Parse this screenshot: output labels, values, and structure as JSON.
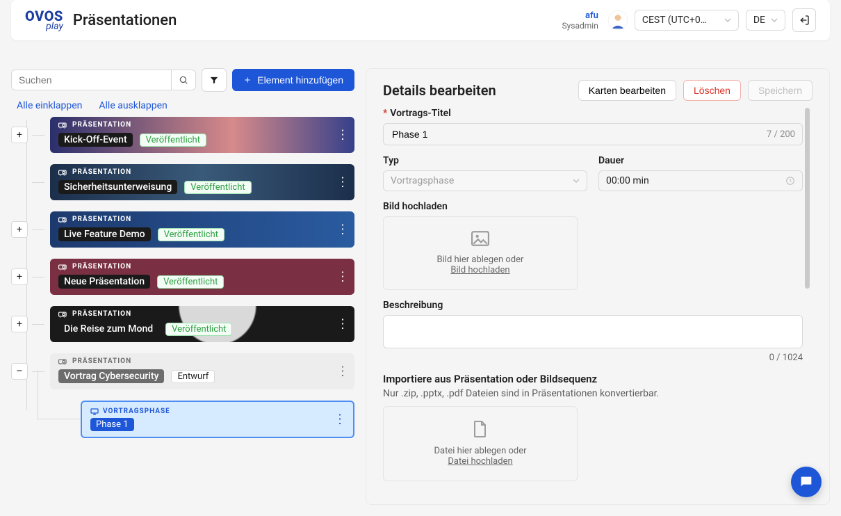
{
  "header": {
    "logo_line1": "OVOS",
    "logo_line2": "play",
    "page_title": "Präsentationen",
    "user_name": "afu",
    "user_role": "Sysadmin",
    "timezone": "CEST (UTC+0…",
    "language": "DE"
  },
  "toolbar": {
    "search_placeholder": "Suchen",
    "add_label": "Element hinzufügen",
    "collapse_all": "Alle einklappen",
    "expand_all": "Alle ausklappen"
  },
  "cards": {
    "overline": "PRÄSENTATION",
    "published": "Veröffentlicht",
    "draft": "Entwurf",
    "items": [
      {
        "title": "Kick-Off-Event",
        "status": "published",
        "toggle": "+",
        "bg": "bg1"
      },
      {
        "title": "Sicherheitsunterweisung",
        "status": "published",
        "toggle": "",
        "bg": "bg2"
      },
      {
        "title": "Live Feature Demo",
        "status": "published",
        "toggle": "+",
        "bg": "bg3"
      },
      {
        "title": "Neue Präsentation",
        "status": "published",
        "toggle": "+",
        "bg": "bg4"
      },
      {
        "title": "Die Reise zum Mond",
        "status": "published",
        "toggle": "+",
        "bg": "bg5"
      },
      {
        "title": "Vortrag Cybersecurity",
        "status": "draft",
        "toggle": "–",
        "bg": "draft"
      }
    ],
    "phase_overline": "VORTRAGSPHASE",
    "phase_label": "Phase 1"
  },
  "details": {
    "title": "Details bearbeiten",
    "edit_cards": "Karten bearbeiten",
    "delete": "Löschen",
    "save": "Speichern",
    "field_title_label": "Vortrags-Titel",
    "field_title_value": "Phase 1",
    "field_title_counter": "7 / 200",
    "type_label": "Typ",
    "type_value": "Vortragsphase",
    "duration_label": "Dauer",
    "duration_value": "00:00 min",
    "upload_label": "Bild hochladen",
    "upload_hint": "Bild hier ablegen oder",
    "upload_link": "Bild hochladen",
    "desc_label": "Beschreibung",
    "desc_counter": "0 / 1024",
    "import_title": "Importiere aus Präsentation oder Bildsequenz",
    "import_sub": "Nur .zip, .pptx, .pdf Dateien sind in Präsentationen konvertierbar.",
    "file_hint": "Datei hier ablegen oder",
    "file_link": "Datei hochladen"
  }
}
